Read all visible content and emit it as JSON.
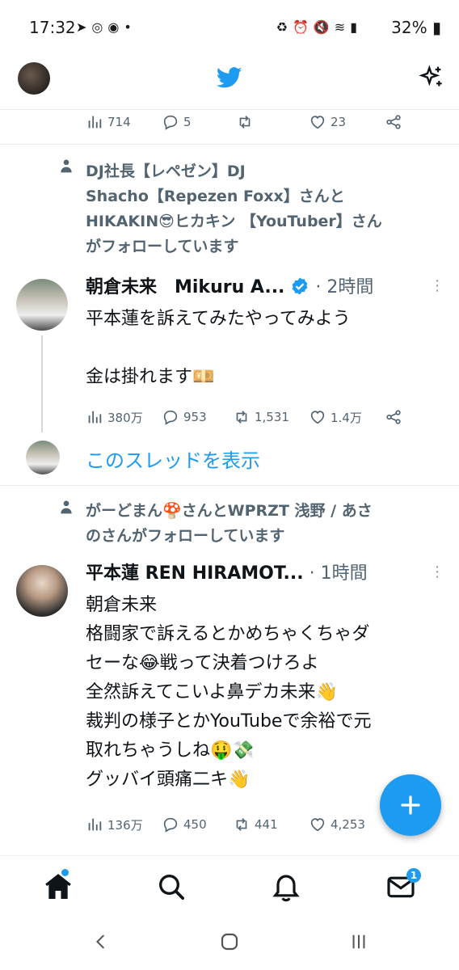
{
  "status_bar": {
    "time": "17:32",
    "left_icons": [
      "navigation-icon",
      "instagram-icon",
      "chrome-icon",
      "dot-icon"
    ],
    "right_icons": [
      "battery-saver-icon",
      "alarm-icon",
      "mute-icon",
      "wifi-icon",
      "signal-icon"
    ],
    "battery": "32%"
  },
  "header": {
    "logo": "twitter-bird-icon",
    "right_icon": "sparkle-icon"
  },
  "prev_tweet_actions": {
    "views": "714",
    "replies": "5",
    "retweets": "",
    "likes": "23"
  },
  "tweets": [
    {
      "social_context": "DJ社長【レペゼン】DJ Shacho【Repezen Foxx】さんとHIKAKIN😎ヒカキン【YouTuber】さんがフォローしています",
      "context_lines": [
        "DJ社長【レペゼン】DJ",
        "Shacho【Repezen Foxx】さんと",
        "HIKAKIN😎ヒカキン 【YouTuber】さん",
        "がフォローしています"
      ],
      "author": "朝倉未来　Mikuru A...",
      "verified": true,
      "time": "· 2時間",
      "text_lines": [
        "平本蓮を訴えてみたやってみよう",
        "",
        "金は掛れます💴"
      ],
      "views": "380万",
      "replies": "953",
      "retweets": "1,531",
      "likes": "1.4万",
      "show_thread": "このスレッドを表示"
    },
    {
      "context_lines": [
        "がーどまん🍄さんとWPRZT 浅野 / あさ",
        "のさんがフォローしています"
      ],
      "author": "平本蓮 REN HIRAMOT...",
      "time": "· 1時間",
      "text_lines": [
        "朝倉未来",
        "格闘家で訴えるとかめちゃくちゃダ",
        "セーな😂戦って決着つけろよ",
        "全然訴えてこいよ鼻デカ未来👋",
        "裁判の様子とかYouTubeで余裕で元",
        "取れちゃうしね🤑💸",
        "グッバイ頭痛二キ👋"
      ],
      "views": "136万",
      "replies": "450",
      "retweets": "441",
      "likes": "4,253"
    }
  ],
  "fab": {
    "icon": "plus-icon"
  },
  "bottom_nav": {
    "items": [
      "home-icon",
      "search-icon",
      "notifications-icon",
      "messages-icon"
    ],
    "messages_badge": "1"
  },
  "system_nav": [
    "back-icon",
    "home-circle-icon",
    "recents-icon"
  ],
  "colors": {
    "accent": "#1d9bf0",
    "secondary_text": "#536471"
  }
}
